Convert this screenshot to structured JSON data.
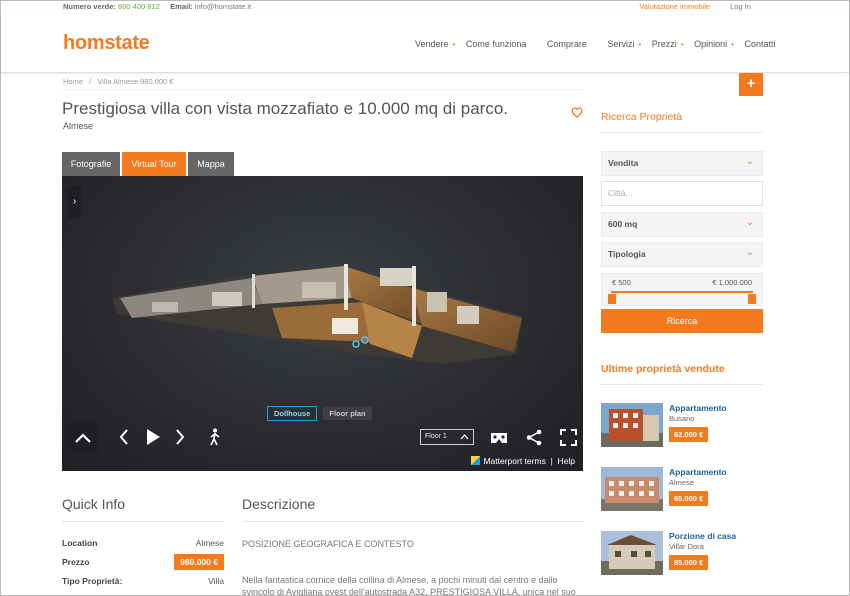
{
  "topbar": {
    "phone_label": "Numero verde:",
    "phone": "800 400 812",
    "email_label": "Email:",
    "email": "info@homstate.it",
    "valuation": "Valutazione immobile",
    "login": "Log In"
  },
  "brand": {
    "logo": "homstate",
    "accent": "#f47a20"
  },
  "nav": [
    {
      "label": "Vendere",
      "dot": true
    },
    {
      "label": "Come funziona",
      "dot": false
    },
    {
      "label": "Comprare",
      "dot": false
    },
    {
      "label": "Servizi",
      "dot": true
    },
    {
      "label": "Prezzi",
      "dot": true
    },
    {
      "label": "Opinioni",
      "dot": true
    },
    {
      "label": "Contatti",
      "dot": false
    }
  ],
  "nav_dot": "•",
  "breadcrumb": {
    "home": "Home",
    "sep": "/",
    "current": "Villa Almese 980.000 €"
  },
  "plus_label": "+",
  "listing": {
    "title": "Prestigiosa villa con vista mozzafiato e 10.000 mq di parco.",
    "location": "Almese"
  },
  "tabs": [
    {
      "label": "Fotografie",
      "active": false
    },
    {
      "label": "Virtual Tour",
      "active": true
    },
    {
      "label": "Mappa",
      "active": false
    }
  ],
  "viewer": {
    "mode_dollhouse": "Dollhouse",
    "mode_floorplan": "Floor plan",
    "floor": "Floor 1",
    "terms": "Matterport terms",
    "separator": "|",
    "help": "Help"
  },
  "quick_info": {
    "title": "Quick Info",
    "rows": [
      {
        "key": "Location",
        "value": "Almese",
        "badge": false
      },
      {
        "key": "Prezzo",
        "value": "980.000 €",
        "badge": true
      },
      {
        "key": "Tipo Proprietà:",
        "value": "Villa",
        "badge": false
      }
    ]
  },
  "description": {
    "title": "Descrizione",
    "heading": "POSIZIONE GEOGRAFICA E CONTESTO",
    "text": "Nella fantastica cornice della collina di Almese, a pochi minuti dal centro e dallo svincolo di Avigliana ovest dell'autostrada A32, PRESTIGIOSA VILLA, unica nel suo genere, con"
  },
  "search": {
    "title": "Ricerca Proprietà",
    "contract": "Vendita",
    "city_placeholder": "Città...",
    "size": "600 mq",
    "type": "Tipologia",
    "price_min": "€ 500",
    "price_max": "€ 1.000.000",
    "button": "Ricerca"
  },
  "sold": {
    "title": "Ultime proprietà vendute",
    "items": [
      {
        "title": "Appartamento",
        "location": "Busano",
        "price": "62.000 €"
      },
      {
        "title": "Appartamento",
        "location": "Almese",
        "price": "65.000 €"
      },
      {
        "title": "Porzione di casa",
        "location": "Villar Dora",
        "price": "85.000 €"
      }
    ]
  }
}
